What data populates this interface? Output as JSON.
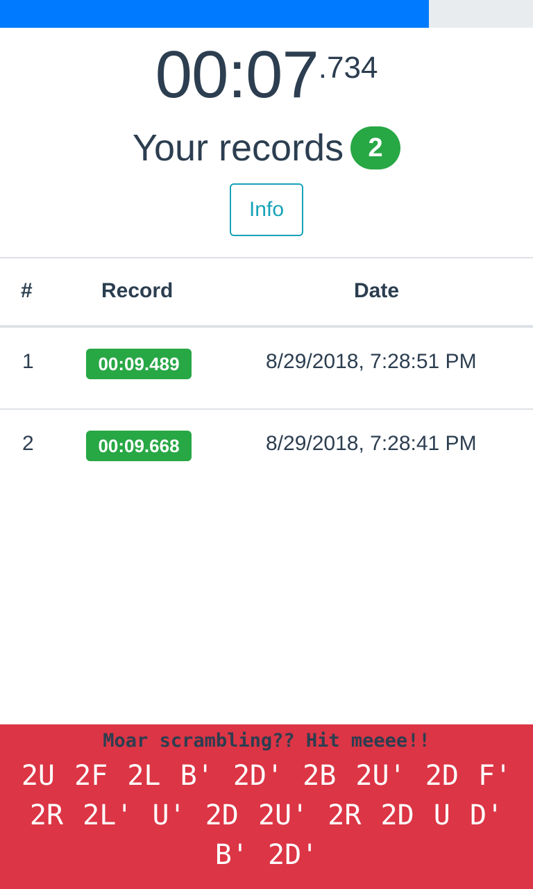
{
  "progress": {
    "percent": 80.5,
    "fill_color": "#007bff",
    "track_color": "#e9ecef"
  },
  "timer": {
    "main": "00:07",
    "ms": ".734"
  },
  "records_heading": {
    "label": "Your records",
    "count": "2"
  },
  "info_button": {
    "label": "Info"
  },
  "table": {
    "headers": {
      "index": "#",
      "record": "Record",
      "date": "Date"
    },
    "rows": [
      {
        "index": "1",
        "record": "00:09.489",
        "date": "8/29/2018, 7:28:51 PM"
      },
      {
        "index": "2",
        "record": "00:09.668",
        "date": "8/29/2018, 7:28:41 PM"
      }
    ]
  },
  "scramble": {
    "prompt": "Moar scrambling?? Hit meeee!!",
    "sequence": "2U 2F 2L B' 2D' 2B 2U' 2D F' 2R 2L' U' 2D 2U' 2R 2D U D' B' 2D'",
    "background_color": "#dc3545"
  },
  "colors": {
    "success": "#28a745",
    "info": "#17a2b8",
    "text": "#2c3e50"
  }
}
